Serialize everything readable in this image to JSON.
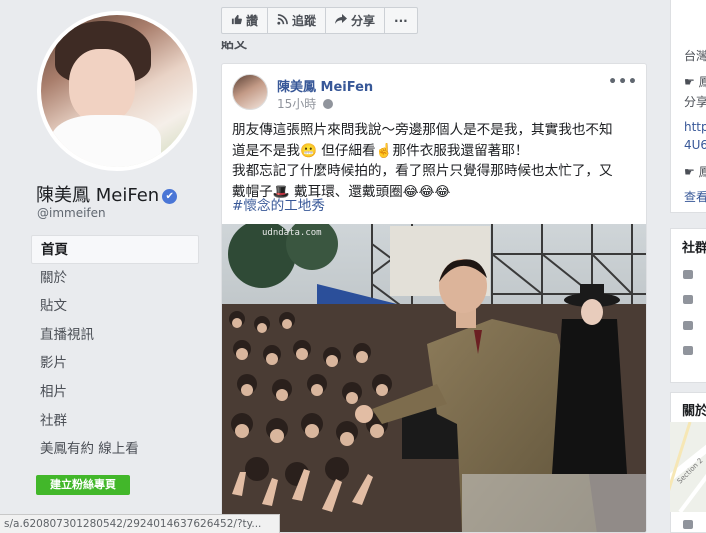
{
  "sidebar": {
    "page_name": "陳美鳳 MeiFen",
    "verified_mark": "✔",
    "handle": "@immeifen",
    "nav": [
      {
        "label": "首頁",
        "active": true
      },
      {
        "label": "關於"
      },
      {
        "label": "貼文"
      },
      {
        "label": "直播視訊"
      },
      {
        "label": "影片"
      },
      {
        "label": "相片"
      },
      {
        "label": "社群"
      },
      {
        "label": "美鳳有約 線上看"
      }
    ],
    "create_page_button": "建立粉絲專頁"
  },
  "actions": {
    "like": "讚",
    "follow": "追蹤",
    "share": "分享",
    "more": "···"
  },
  "feed_heading": "貼文",
  "post": {
    "author": "陳美鳳 MeiFen",
    "time": "15小時",
    "text_lines": [
      "朋友傳這張照片來問我說～旁邊那個人是不是我，其實我也不知",
      "道是不是我😬 但仔細看☝️那件衣服我還留著耶！",
      "我都忘記了什麼時候拍的，看了照片只覺得那時候也太忙了，又",
      "戴帽子🎩 戴耳環、還戴頭圈😂😂😂"
    ],
    "hashtag": "#懷念的工地秀",
    "photo_watermark": "udndata.com"
  },
  "status_url": "s/a.620807301280542/2924014637626452/?ty...",
  "right_column": {
    "box1_lines": [
      "台灣",
      "☛ 鳳",
      "分享",
      "http",
      "4U6",
      "☛ 鳳",
      "查看"
    ],
    "community_title": "社群",
    "about_title": "關於",
    "map_street": "Section 2"
  },
  "colors": {
    "link": "#385898",
    "brand_blue": "#4267b2",
    "green_button": "#42b72a",
    "verified": "#4a76d6"
  },
  "icons": [
    "like-icon",
    "follow-icon",
    "share-icon",
    "more-icon",
    "globe-icon",
    "verified-icon",
    "people-icon",
    "thumb-icon",
    "rss-icon",
    "group-icon"
  ]
}
